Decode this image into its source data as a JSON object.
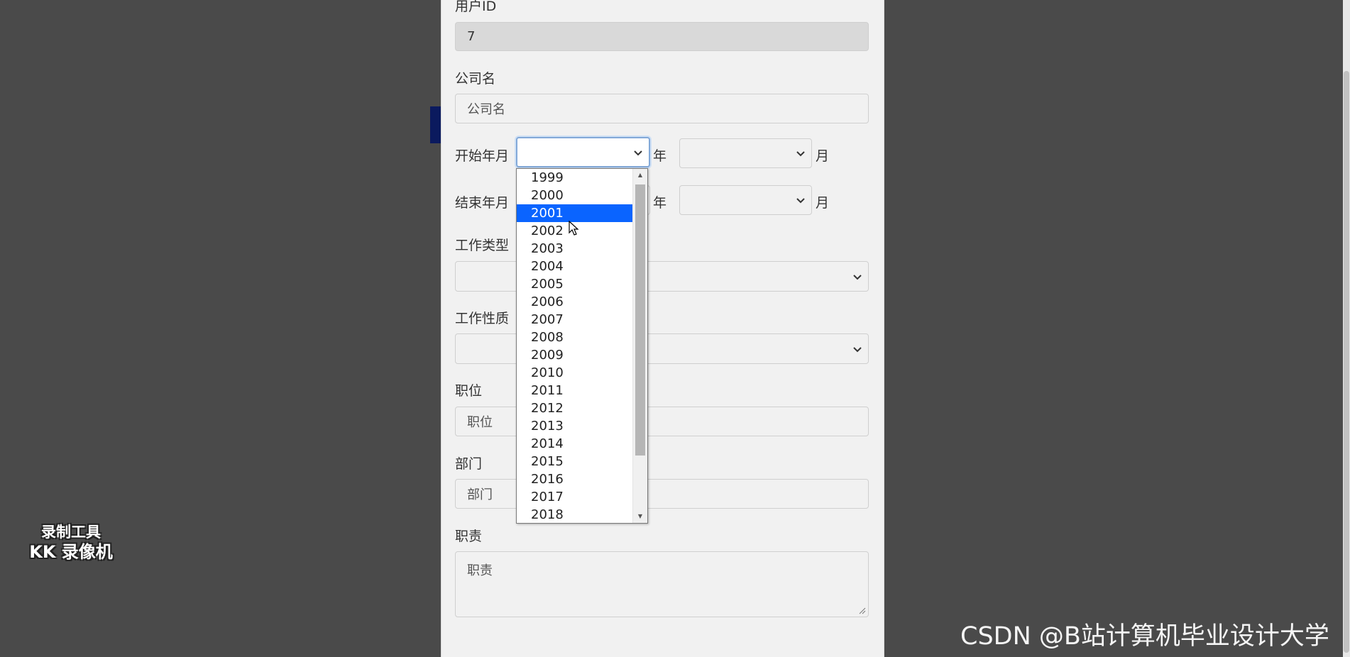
{
  "form": {
    "user_id_label": "用户ID",
    "user_id_value": "7",
    "company_label": "公司名",
    "company_placeholder": "公司名",
    "start_label": "开始年月",
    "end_label": "结束年月",
    "year_unit": "年",
    "month_unit": "月",
    "job_type_label": "工作类型",
    "job_nature_label": "工作性质",
    "position_label": "职位",
    "position_placeholder": "职位",
    "department_label": "部门",
    "department_placeholder": "部门",
    "duty_label": "职责",
    "duty_placeholder": "职责"
  },
  "year_dropdown": {
    "options": [
      "1999",
      "2000",
      "2001",
      "2002",
      "2003",
      "2004",
      "2005",
      "2006",
      "2007",
      "2008",
      "2009",
      "2010",
      "2011",
      "2012",
      "2013",
      "2014",
      "2015",
      "2016",
      "2017",
      "2018"
    ],
    "highlighted": "2001"
  },
  "watermarks": {
    "recorder_line1": "录制工具",
    "recorder_line2": "KK 录像机",
    "csdn": "CSDN @B站计算机毕业设计大学"
  },
  "colors": {
    "backdrop": "#4a4a4a",
    "panel": "#f1f1f1",
    "highlight": "#0a64ff"
  }
}
